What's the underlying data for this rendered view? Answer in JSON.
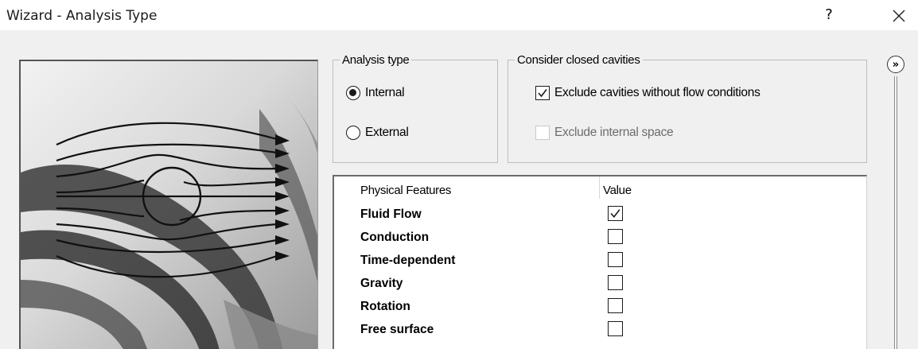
{
  "window": {
    "title": "Wizard - Analysis Type",
    "help_label": "?",
    "close_icon": "close-icon"
  },
  "analysis_type": {
    "title": "Analysis type",
    "options": [
      {
        "label": "Internal",
        "selected": true
      },
      {
        "label": "External",
        "selected": false
      }
    ]
  },
  "cavities": {
    "title": "Consider closed cavities",
    "exclude_no_flow": {
      "label": "Exclude cavities without flow conditions",
      "checked": true,
      "enabled": true
    },
    "exclude_internal": {
      "label": "Exclude internal space",
      "checked": false,
      "enabled": false
    }
  },
  "features_table": {
    "headers": [
      "Physical Features",
      "Value"
    ],
    "rows": [
      {
        "name": "Fluid Flow",
        "checked": true
      },
      {
        "name": "Conduction",
        "checked": false
      },
      {
        "name": "Time-dependent",
        "checked": false
      },
      {
        "name": "Gravity",
        "checked": false
      },
      {
        "name": "Rotation",
        "checked": false
      },
      {
        "name": "Free surface",
        "checked": false
      }
    ]
  },
  "side_panel": {
    "expand_label": "»",
    "expand_icon": "double-chevron-right-icon"
  },
  "illustration": {
    "icon": "flow-around-cylinder-illustration"
  }
}
